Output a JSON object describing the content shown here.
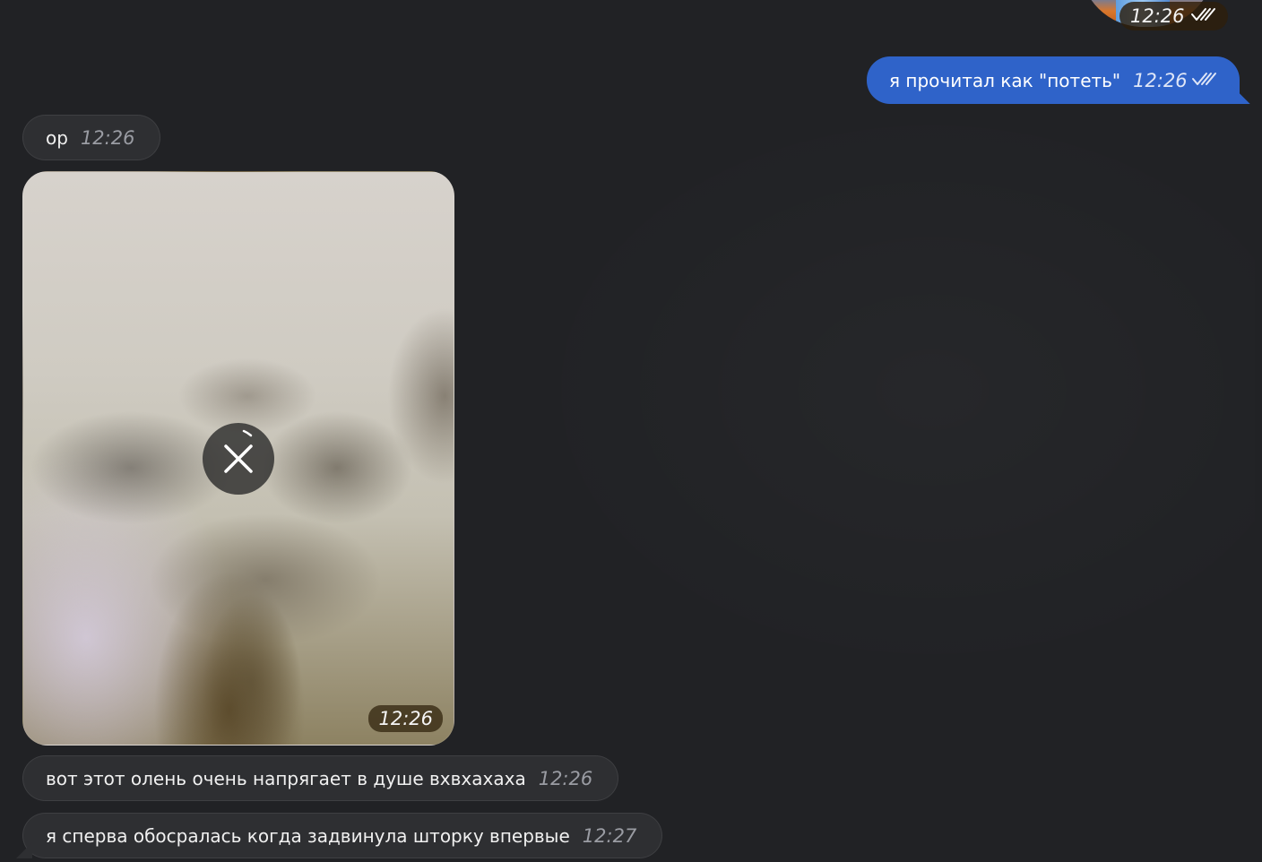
{
  "top_sticker": {
    "time": "12:26",
    "status_icon": "double-check-icon"
  },
  "messages": [
    {
      "id": "out-1",
      "direction": "outgoing",
      "text": "я прочитал как \"потеть\"",
      "time": "12:26",
      "status_icon": "double-check-icon"
    },
    {
      "id": "in-1",
      "direction": "incoming",
      "text": "ор",
      "time": "12:26"
    },
    {
      "id": "in-photo",
      "direction": "incoming",
      "type": "photo",
      "time": "12:26",
      "overlay_icon": "close-icon"
    },
    {
      "id": "in-2",
      "direction": "incoming",
      "text": "вот этот олень очень напрягает в душе вхвхахаха",
      "time": "12:26"
    },
    {
      "id": "in-3",
      "direction": "incoming",
      "text": "я сперва обосралась когда задвинула шторку впервые",
      "time": "12:27"
    }
  ],
  "colors": {
    "background": "#212225",
    "outgoing_bubble": "#2f63c9",
    "incoming_bubble": "#2e2f32",
    "time_text_incoming": "#9a9ca3"
  }
}
